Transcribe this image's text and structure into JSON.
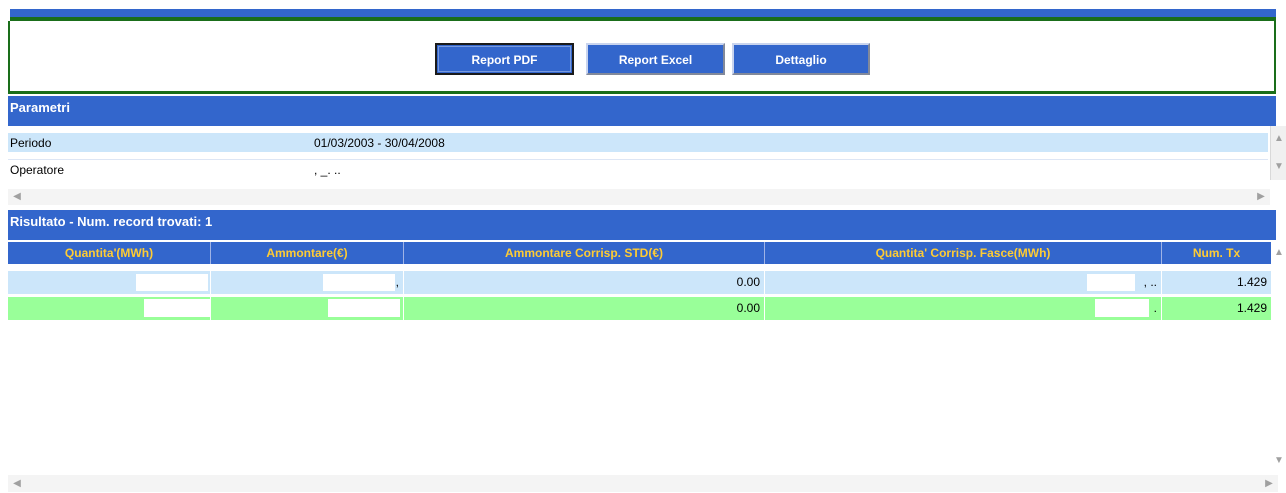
{
  "toolbar": {
    "report_pdf_label": "Report PDF",
    "report_excel_label": "Report Excel",
    "dettaglio_label": "Dettaglio"
  },
  "parametri": {
    "title": "Parametri",
    "rows": [
      {
        "label": "Periodo",
        "value": "01/03/2003 - 30/04/2008"
      },
      {
        "label": "Operatore",
        "value": ",                    _.   .."
      }
    ]
  },
  "risultato": {
    "title": "Risultato - Num. record trovati: 1",
    "columns": [
      "Quantita'(MWh)",
      "Ammontare(€)",
      "Ammontare Corrisp. STD(€)",
      "Quantita' Corrisp. Fasce(MWh)",
      "Num. Tx"
    ],
    "rows": [
      {
        "quantita": "",
        "ammontare": ",",
        "ammontare_std": "0.00",
        "quantita_fasce": ", ..",
        "num_tx": "1.429"
      },
      {
        "quantita": "",
        "ammontare": "",
        "ammontare_std": "0.00",
        "quantita_fasce": ".",
        "num_tx": "1.429"
      }
    ]
  },
  "icons": {
    "scroll_left": "chevron-left-icon",
    "scroll_right": "chevron-right-icon",
    "scroll_up": "chevron-up-icon",
    "scroll_down": "chevron-down-icon"
  },
  "colors": {
    "header_blue": "#3366cc",
    "border_green": "#1a6e1a",
    "row_light_blue": "#cce6fa",
    "row_light_green": "#99ff99",
    "column_header_text": "#ffcc33"
  }
}
